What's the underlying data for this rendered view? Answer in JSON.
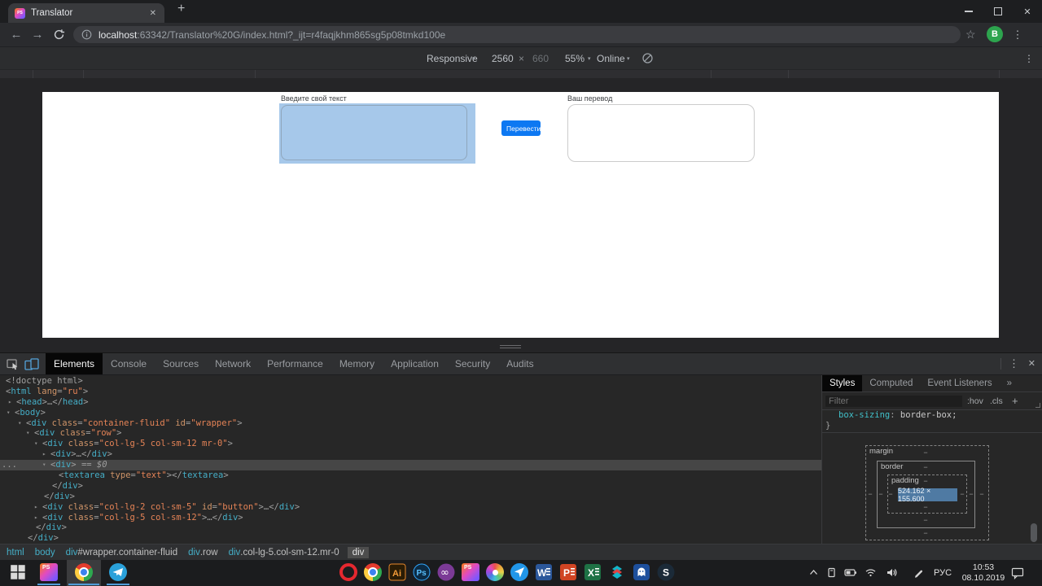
{
  "window": {
    "tab_title": "Translator",
    "favicon_text": "PS",
    "avatar": "B",
    "icons": {
      "close": "✕",
      "plus": "+",
      "back": "←",
      "forward": "→",
      "star": "☆",
      "dots": "⋮",
      "dropdown": "▾",
      "collapse": "▾",
      "expand": "▸"
    }
  },
  "nav": {
    "url_host": "localhost",
    "url_rest": ":63342/Translator%20G/index.html?_ijt=r4faqjkhm865sg5p08tmkd100e"
  },
  "device_toolbar": {
    "mode": "Responsive",
    "width": "2560",
    "sep": "×",
    "height": "660",
    "zoom": "55%",
    "network": "Online"
  },
  "page": {
    "source_label": "Введите свой текст",
    "button": "Перевести",
    "target_label": "Ваш перевод"
  },
  "colors": {
    "accent_button": "#0d78f2",
    "inspect_highlight": "#a6c8ea",
    "devtools_selection": "#464646",
    "taskbar_underline": "#4f9cd8"
  },
  "devtools": {
    "tabs": [
      "Elements",
      "Console",
      "Sources",
      "Network",
      "Performance",
      "Memory",
      "Application",
      "Security",
      "Audits"
    ],
    "active_tab": 0,
    "tree": [
      {
        "i": 7,
        "tk": [
          [
            "p",
            "<!doctype html>"
          ]
        ]
      },
      {
        "i": 7,
        "tk": [
          [
            "p",
            "<"
          ],
          [
            "t",
            "html"
          ],
          [
            "a",
            " lang"
          ],
          [
            "p",
            "="
          ],
          [
            "v",
            "\"ru\""
          ],
          [
            "p",
            ">"
          ]
        ]
      },
      {
        "i": 20,
        "a": "▸",
        "tk": [
          [
            "p",
            "<"
          ],
          [
            "t",
            "head"
          ],
          [
            "p",
            ">…</"
          ],
          [
            "t",
            "head"
          ],
          [
            "p",
            ">"
          ]
        ]
      },
      {
        "i": 18,
        "a": "▾",
        "tk": [
          [
            "p",
            "<"
          ],
          [
            "t",
            "body"
          ],
          [
            "p",
            ">"
          ]
        ]
      },
      {
        "i": 32,
        "a": "▾",
        "tk": [
          [
            "p",
            "<"
          ],
          [
            "t",
            "div"
          ],
          [
            "a",
            " class"
          ],
          [
            "p",
            "="
          ],
          [
            "v",
            "\"container-fluid\""
          ],
          [
            "a",
            " id"
          ],
          [
            "p",
            "="
          ],
          [
            "v",
            "\"wrapper\""
          ],
          [
            "p",
            ">"
          ]
        ]
      },
      {
        "i": 42,
        "a": "▾",
        "tk": [
          [
            "p",
            "<"
          ],
          [
            "t",
            "div"
          ],
          [
            "a",
            " class"
          ],
          [
            "p",
            "="
          ],
          [
            "v",
            "\"row\""
          ],
          [
            "p",
            ">"
          ]
        ]
      },
      {
        "i": 52,
        "a": "▾",
        "tk": [
          [
            "p",
            "<"
          ],
          [
            "t",
            "div"
          ],
          [
            "a",
            " class"
          ],
          [
            "p",
            "="
          ],
          [
            "v",
            "\"col-lg-5 col-sm-12 mr-0\""
          ],
          [
            "p",
            ">"
          ]
        ]
      },
      {
        "i": 62,
        "a": "▸",
        "tk": [
          [
            "p",
            "<"
          ],
          [
            "t",
            "div"
          ],
          [
            "p",
            ">…</"
          ],
          [
            "t",
            "div"
          ],
          [
            "p",
            ">"
          ]
        ]
      },
      {
        "i": 62,
        "a": "▾",
        "sel": true,
        "g": "...",
        "tk": [
          [
            "p",
            "<"
          ],
          [
            "t",
            "div"
          ],
          [
            "p",
            ">"
          ],
          [
            "s",
            " == $0"
          ]
        ]
      },
      {
        "i": 72,
        "tk": [
          [
            "p",
            "<"
          ],
          [
            "t",
            "textarea"
          ],
          [
            "a",
            " type"
          ],
          [
            "p",
            "="
          ],
          [
            "v",
            "\"text\""
          ],
          [
            "p",
            "></"
          ],
          [
            "t",
            "textarea"
          ],
          [
            "p",
            ">"
          ]
        ]
      },
      {
        "i": 64,
        "tk": [
          [
            "p",
            "</"
          ],
          [
            "t",
            "div"
          ],
          [
            "p",
            ">"
          ]
        ]
      },
      {
        "i": 54,
        "tk": [
          [
            "p",
            "</"
          ],
          [
            "t",
            "div"
          ],
          [
            "p",
            ">"
          ]
        ]
      },
      {
        "i": 52,
        "a": "▸",
        "tk": [
          [
            "p",
            "<"
          ],
          [
            "t",
            "div"
          ],
          [
            "a",
            " class"
          ],
          [
            "p",
            "="
          ],
          [
            "v",
            "\"col-lg-2 col-sm-5\""
          ],
          [
            "a",
            " id"
          ],
          [
            "p",
            "="
          ],
          [
            "v",
            "\"button\""
          ],
          [
            "p",
            ">…</"
          ],
          [
            "t",
            "div"
          ],
          [
            "p",
            ">"
          ]
        ]
      },
      {
        "i": 52,
        "a": "▸",
        "tk": [
          [
            "p",
            "<"
          ],
          [
            "t",
            "div"
          ],
          [
            "a",
            " class"
          ],
          [
            "p",
            "="
          ],
          [
            "v",
            "\"col-lg-5 col-sm-12\""
          ],
          [
            "p",
            ">…</"
          ],
          [
            "t",
            "div"
          ],
          [
            "p",
            ">"
          ]
        ]
      },
      {
        "i": 44,
        "tk": [
          [
            "p",
            "</"
          ],
          [
            "t",
            "div"
          ],
          [
            "p",
            ">"
          ]
        ]
      },
      {
        "i": 34,
        "tk": [
          [
            "p",
            "</"
          ],
          [
            "t",
            "div"
          ],
          [
            "p",
            ">"
          ]
        ]
      }
    ],
    "breadcrumbs": [
      {
        "tag": "html"
      },
      {
        "tag": "body"
      },
      {
        "tag": "div",
        "rest": "#wrapper.container-fluid"
      },
      {
        "tag": "div",
        "rest": ".row"
      },
      {
        "tag": "div",
        "rest": ".col-lg-5.col-sm-12.mr-0"
      },
      {
        "tag": "div",
        "sel": true
      }
    ],
    "styles": {
      "tabs": [
        "Styles",
        "Computed",
        "Event Listeners",
        "»"
      ],
      "active_tab": 0,
      "filter_placeholder": "Filter",
      "pseudo": ":hov",
      "classes": ".cls",
      "add": "+",
      "rule": {
        "property": "box-sizing",
        "colon": ": ",
        "value": "border-box;",
        "close": "}"
      },
      "box": {
        "margin": "margin",
        "border": "border",
        "padding": "padding",
        "size": "524.162 × 155.600",
        "dash": "−"
      }
    }
  },
  "taskbar": {
    "apps": [
      {
        "icon": "windows-start"
      },
      {
        "icon": "phpstorm",
        "running": true
      },
      {
        "icon": "chrome",
        "running": true,
        "active": true
      },
      {
        "icon": "telegram",
        "running": true
      },
      {
        "icon": "opera"
      },
      {
        "icon": "chrome-secondary"
      },
      {
        "icon": "illustrator"
      },
      {
        "icon": "photoshop"
      },
      {
        "icon": "visual-studio"
      },
      {
        "icon": "phpstorm-pinned"
      },
      {
        "icon": "color-wheel-app"
      },
      {
        "icon": "navigator-app"
      },
      {
        "icon": "word"
      },
      {
        "icon": "powerpoint"
      },
      {
        "icon": "excel"
      },
      {
        "icon": "s-logo-app"
      },
      {
        "icon": "ghost-app"
      },
      {
        "icon": "dark-s-app"
      }
    ],
    "tray": {
      "language": "РУС",
      "time": "10:53",
      "date": "08.10.2019"
    }
  }
}
